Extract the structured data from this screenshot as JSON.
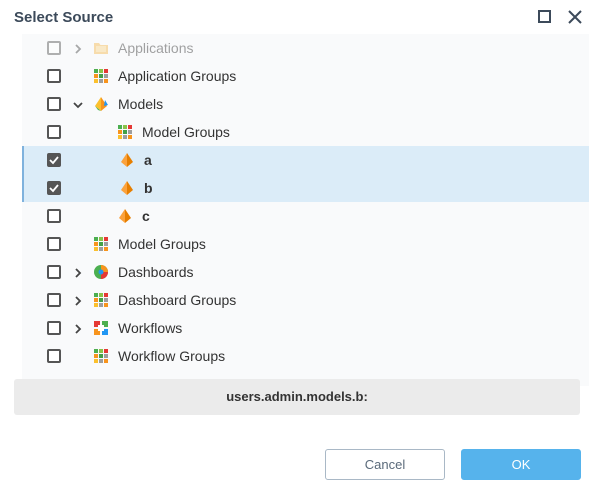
{
  "dialog": {
    "title": "Select Source",
    "maximize_icon": "maximize-icon",
    "close_icon": "close-icon"
  },
  "tree": {
    "rows": [
      {
        "label": "Applications",
        "checked": false,
        "expandable": true,
        "expanded": false,
        "icon": "folder-icon",
        "level": 0,
        "faded": true
      },
      {
        "label": "Application Groups",
        "checked": false,
        "expandable": false,
        "icon": "group-grid-icon",
        "level": 0
      },
      {
        "label": "Models",
        "checked": false,
        "expandable": true,
        "expanded": true,
        "icon": "models-icon",
        "level": 0
      },
      {
        "label": "Model Groups",
        "checked": false,
        "expandable": false,
        "icon": "group-grid-icon",
        "level": 1
      },
      {
        "label": "a",
        "checked": true,
        "expandable": false,
        "icon": "model-icon",
        "level": 1,
        "selected": true
      },
      {
        "label": "b",
        "checked": true,
        "expandable": false,
        "icon": "model-icon",
        "level": 1,
        "selected": true
      },
      {
        "label": "c",
        "checked": false,
        "expandable": false,
        "icon": "model-icon",
        "level": 1
      },
      {
        "label": "Model Groups",
        "checked": false,
        "expandable": false,
        "icon": "group-grid-icon",
        "level": 0
      },
      {
        "label": "Dashboards",
        "checked": false,
        "expandable": true,
        "expanded": false,
        "icon": "dashboard-icon",
        "level": 0
      },
      {
        "label": "Dashboard Groups",
        "checked": false,
        "expandable": true,
        "expanded": false,
        "icon": "group-grid-icon",
        "level": 0
      },
      {
        "label": "Workflows",
        "checked": false,
        "expandable": true,
        "expanded": false,
        "icon": "workflow-icon",
        "level": 0
      },
      {
        "label": "Workflow Groups",
        "checked": false,
        "expandable": false,
        "icon": "group-grid-icon",
        "level": 0
      }
    ]
  },
  "path_bar": {
    "text": "users.admin.models.b:"
  },
  "buttons": {
    "cancel": "Cancel",
    "ok": "OK"
  },
  "colors": {
    "accent": "#56b3ec",
    "selected_row": "#dbecf8",
    "model_orange": "#f7941d",
    "title": "#3c4a5a"
  }
}
